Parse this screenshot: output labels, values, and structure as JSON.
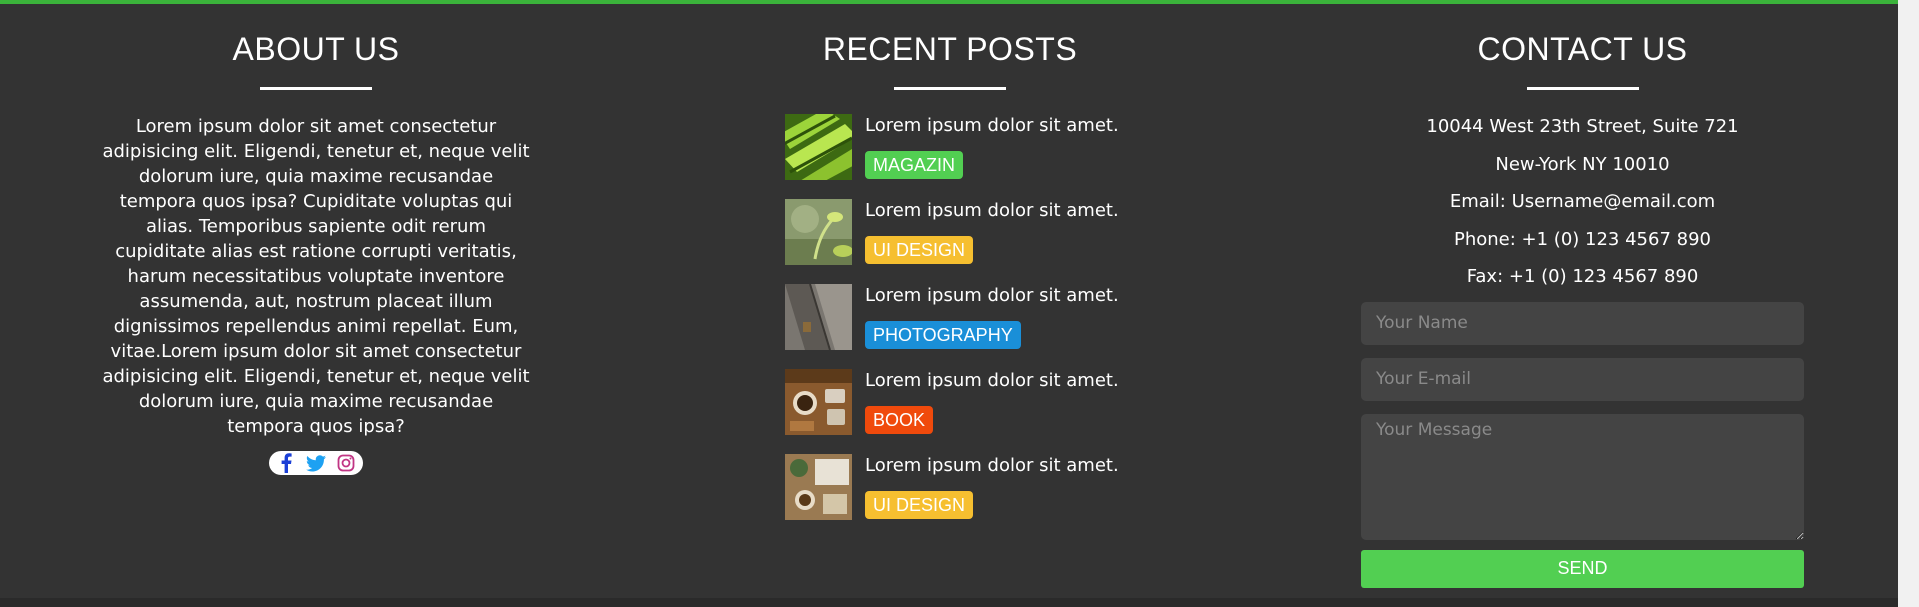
{
  "about": {
    "title": "ABOUT US",
    "text": "Lorem ipsum dolor sit amet consectetur adipisicing elit. Eligendi, tenetur et, neque velit dolorum iure, quia maxime recusandae tempora quos ipsa? Cupiditate voluptas qui alias. Temporibus sapiente odit rerum cupiditate alias est ratione corrupti veritatis, harum necessitatibus voluptate inventore assumenda, aut, nostrum placeat illum dignissimos repellendus animi repellat. Eum, vitae.Lorem ipsum dolor sit amet consectetur adipisicing elit. Eligendi, tenetur et, neque velit dolorum iure, quia maxime recusandae tempora quos ipsa?",
    "social": [
      {
        "icon": "facebook-icon",
        "color": "#1b3fd6"
      },
      {
        "icon": "twitter-icon",
        "color": "#1da1f2"
      },
      {
        "icon": "instagram-icon",
        "color": "#c13584"
      }
    ]
  },
  "posts": {
    "title": "RECENT POSTS",
    "items": [
      {
        "title": "Lorem ipsum dolor sit amet.",
        "tag": "MAGAZIN",
        "tag_color": "#52cf52",
        "thumb": "green-leaves-image"
      },
      {
        "title": "Lorem ipsum dolor sit amet.",
        "tag": "UI DESIGN",
        "tag_color": "#f6bf30",
        "thumb": "plant-sprout-image"
      },
      {
        "title": "Lorem ipsum dolor sit amet.",
        "tag": "PHOTOGRAPHY",
        "tag_color": "#1a8fd8",
        "thumb": "wood-planks-image"
      },
      {
        "title": "Lorem ipsum dolor sit amet.",
        "tag": "BOOK",
        "tag_color": "#f04a0c",
        "thumb": "coffee-desk-image"
      },
      {
        "title": "Lorem ipsum dolor sit amet.",
        "tag": "UI DESIGN",
        "tag_color": "#f6bf30",
        "thumb": "workspace-image"
      }
    ]
  },
  "contact": {
    "title": "CONTACT US",
    "address1": "10044 West 23th Street, Suite 721",
    "address2": "New-York NY 10010",
    "email": "Email: Username@email.com",
    "phone": "Phone: +1 (0) 123 4567 890",
    "fax": "Fax: +1 (0) 123 4567 890",
    "name_placeholder": "Your Name",
    "email_placeholder": "Your E-mail",
    "message_placeholder": "Your Message",
    "send_label": "SEND"
  },
  "colors": {
    "accent": "#3bb33b",
    "background": "#333333",
    "send_button": "#52cf52"
  }
}
